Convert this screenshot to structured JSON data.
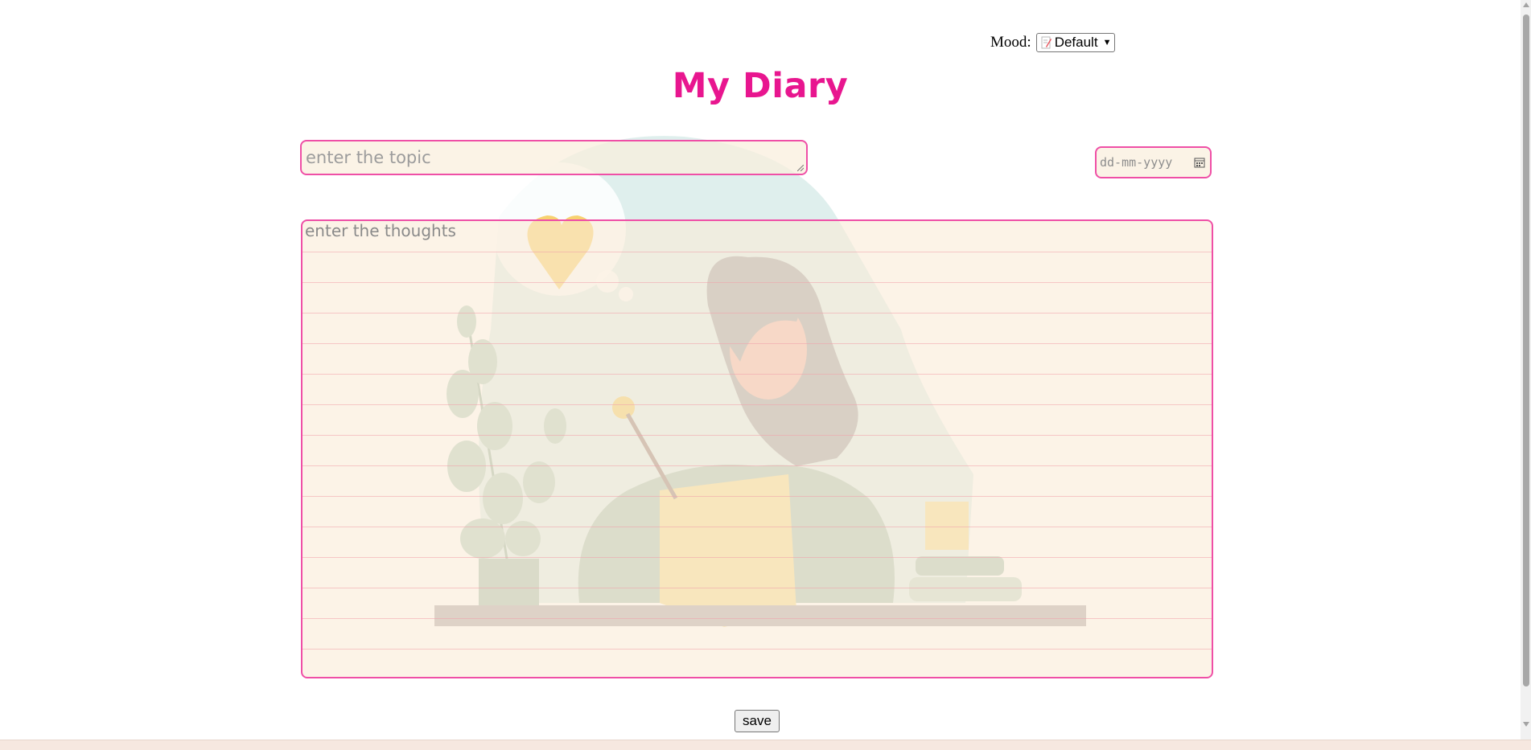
{
  "mood": {
    "label": "Mood:",
    "selected": "Default",
    "icon": "memo-icon"
  },
  "title": "My Diary",
  "topic": {
    "placeholder": "enter the topic"
  },
  "date": {
    "placeholder": "dd-mm-yyyy",
    "icon": "calendar-icon"
  },
  "thoughts": {
    "placeholder": "enter the thoughts"
  },
  "save_label": "save",
  "colors": {
    "accent": "#e8168f",
    "border": "#ef4fa6",
    "paper": "#faeedc"
  }
}
